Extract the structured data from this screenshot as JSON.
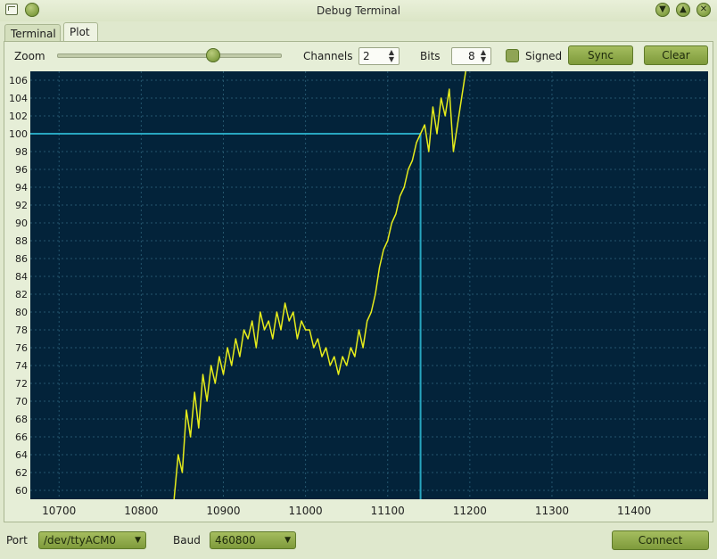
{
  "window": {
    "title": "Debug Terminal"
  },
  "tabs": [
    {
      "label": "Terminal"
    },
    {
      "label": "Plot"
    }
  ],
  "toolbar": {
    "zoom_label": "Zoom",
    "zoom_level": 0.7,
    "channels_label": "Channels",
    "channels_value": "2",
    "bits_label": "Bits",
    "bits_value": "8",
    "signed_label": "Signed",
    "signed_checked": false,
    "sync_label": "Sync",
    "clear_label": "Clear"
  },
  "footer": {
    "port_label": "Port",
    "port_value": "/dev/ttyACM0",
    "baud_label": "Baud",
    "baud_value": "460800",
    "connect_label": "Connect"
  },
  "colors": {
    "plot_bg": "#03233a",
    "grid": "#24566e",
    "trace": "#e6ec1b",
    "cursor": "#28a6c0",
    "accent": "#8fa455"
  },
  "chart_data": {
    "type": "line",
    "x_ticks": [
      10700,
      10800,
      10900,
      11000,
      11100,
      11200,
      11300,
      11400
    ],
    "y_ticks": [
      60,
      62,
      64,
      66,
      68,
      70,
      72,
      74,
      76,
      78,
      80,
      82,
      84,
      86,
      88,
      90,
      92,
      94,
      96,
      98,
      100,
      102,
      104,
      106
    ],
    "xlim": [
      10665,
      11490
    ],
    "ylim": [
      59,
      107
    ],
    "grid": true,
    "cursor": {
      "x": 11140,
      "y": 100
    },
    "series": [
      {
        "x": [
          10840,
          10845,
          10850,
          10855,
          10860,
          10865,
          10870,
          10875,
          10880,
          10885,
          10890,
          10895,
          10900,
          10905,
          10910,
          10915,
          10920,
          10925,
          10930,
          10935,
          10940,
          10945,
          10950,
          10955,
          10960,
          10965,
          10970,
          10975,
          10980,
          10985,
          10990,
          10995,
          11000,
          11005,
          11010,
          11015,
          11020,
          11025,
          11030,
          11035,
          11040,
          11045,
          11050,
          11055,
          11060,
          11065,
          11070,
          11075,
          11080,
          11085,
          11090,
          11095,
          11100,
          11105,
          11110,
          11115,
          11120,
          11125,
          11130,
          11135,
          11140,
          11145,
          11150,
          11155,
          11160,
          11165,
          11170,
          11175,
          11180,
          11185,
          11190,
          11195
        ],
        "y": [
          59,
          64,
          62,
          69,
          66,
          71,
          67,
          73,
          70,
          74,
          72,
          75,
          73,
          76,
          74,
          77,
          75,
          78,
          77,
          79,
          76,
          80,
          78,
          79,
          77,
          80,
          78,
          81,
          79,
          80,
          77,
          79,
          78,
          78,
          76,
          77,
          75,
          76,
          74,
          75,
          73,
          75,
          74,
          76,
          75,
          78,
          76,
          79,
          80,
          82,
          85,
          87,
          88,
          90,
          91,
          93,
          94,
          96,
          97,
          99,
          100,
          101,
          98,
          103,
          100,
          104,
          102,
          105,
          98,
          101,
          104,
          107
        ]
      }
    ]
  }
}
